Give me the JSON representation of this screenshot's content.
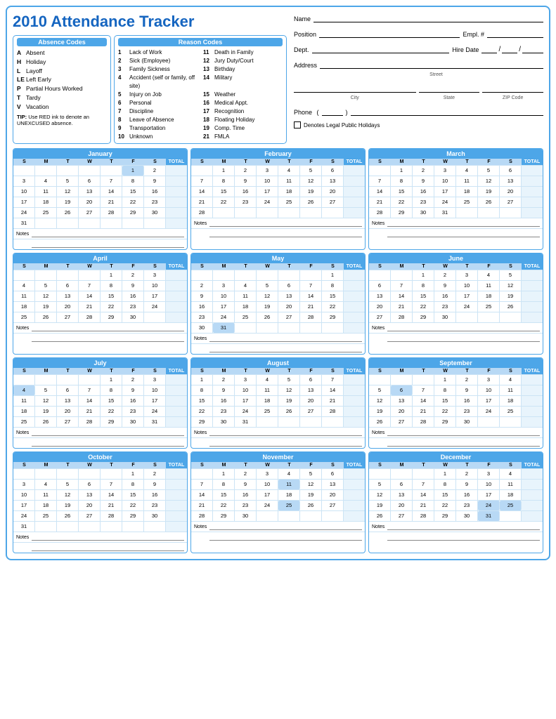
{
  "title": "2010 Attendance Tracker",
  "absenceCodes": {
    "header": "Absence Codes",
    "items": [
      {
        "letter": "A",
        "desc": "Absent"
      },
      {
        "letter": "H",
        "desc": "Holiday"
      },
      {
        "letter": "L",
        "desc": "Layoff"
      },
      {
        "letter": "LE",
        "desc": "Left Early"
      },
      {
        "letter": "P",
        "desc": "Partial Hours Worked"
      },
      {
        "letter": "T",
        "desc": "Tardy"
      },
      {
        "letter": "V",
        "desc": "Vacation"
      }
    ],
    "tip": "TIP: Use RED ink to denote an UNEXCUSED absence."
  },
  "reasonCodes": {
    "header": "Reason Codes",
    "items": [
      {
        "num": "1",
        "desc": "Lack of Work"
      },
      {
        "num": "11",
        "desc": "Death in Family"
      },
      {
        "num": "2",
        "desc": "Sick (Employee)"
      },
      {
        "num": "12",
        "desc": "Jury Duty/Court"
      },
      {
        "num": "3",
        "desc": "Family Sickness"
      },
      {
        "num": "13",
        "desc": "Birthday"
      },
      {
        "num": "4",
        "desc": "Accident (self or family, off site)"
      },
      {
        "num": "14",
        "desc": "Military"
      },
      {
        "num": "5",
        "desc": "Injury on Job"
      },
      {
        "num": "15",
        "desc": "Weather"
      },
      {
        "num": "6",
        "desc": "Personal"
      },
      {
        "num": "16",
        "desc": "Medical Appt."
      },
      {
        "num": "7",
        "desc": "Discipline"
      },
      {
        "num": "17",
        "desc": "Recognition"
      },
      {
        "num": "8",
        "desc": "Leave of Absence"
      },
      {
        "num": "18",
        "desc": "Floating Holiday"
      },
      {
        "num": "9",
        "desc": "Transportation"
      },
      {
        "num": "19",
        "desc": "Comp. Time"
      },
      {
        "num": "10",
        "desc": "Unknown"
      },
      {
        "num": "21",
        "desc": "FMLA"
      }
    ]
  },
  "form": {
    "name_label": "Name",
    "position_label": "Position",
    "empl_label": "Empl. #",
    "dept_label": "Dept.",
    "hire_label": "Hire Date",
    "address_label": "Address",
    "street_label": "Street",
    "city_label": "City",
    "state_label": "State",
    "zip_label": "ZIP Code",
    "phone_label": "Phone",
    "checkbox_label": "Denotes Legal Public Holidays"
  },
  "months": [
    {
      "name": "January",
      "weeks": [
        {
          "cells": [
            "",
            "",
            "",
            "",
            "",
            "1",
            "2"
          ]
        },
        {
          "cells": [
            "3",
            "4",
            "5",
            "6",
            "7",
            "8",
            "9"
          ]
        },
        {
          "cells": [
            "10",
            "11",
            "12",
            "13",
            "14",
            "15",
            "16"
          ]
        },
        {
          "cells": [
            "17",
            "18",
            "19",
            "20",
            "21",
            "22",
            "23"
          ]
        },
        {
          "cells": [
            "24",
            "25",
            "26",
            "27",
            "28",
            "29",
            "30"
          ]
        },
        {
          "cells": [
            "31",
            "",
            "",
            "",
            "",
            "",
            ""
          ]
        }
      ]
    },
    {
      "name": "February",
      "weeks": [
        {
          "cells": [
            "",
            "1",
            "2",
            "3",
            "4",
            "5",
            "6"
          ]
        },
        {
          "cells": [
            "7",
            "8",
            "9",
            "10",
            "11",
            "12",
            "13"
          ]
        },
        {
          "cells": [
            "14",
            "15",
            "16",
            "17",
            "18",
            "19",
            "20"
          ]
        },
        {
          "cells": [
            "21",
            "22",
            "23",
            "24",
            "25",
            "26",
            "27"
          ]
        },
        {
          "cells": [
            "28",
            "",
            "",
            "",
            "",
            "",
            ""
          ]
        }
      ]
    },
    {
      "name": "March",
      "weeks": [
        {
          "cells": [
            "",
            "1",
            "2",
            "3",
            "4",
            "5",
            "6"
          ]
        },
        {
          "cells": [
            "7",
            "8",
            "9",
            "10",
            "11",
            "12",
            "13"
          ]
        },
        {
          "cells": [
            "14",
            "15",
            "16",
            "17",
            "18",
            "19",
            "20"
          ]
        },
        {
          "cells": [
            "21",
            "22",
            "23",
            "24",
            "25",
            "26",
            "27"
          ]
        },
        {
          "cells": [
            "28",
            "29",
            "30",
            "31",
            "",
            "",
            ""
          ]
        }
      ]
    },
    {
      "name": "April",
      "weeks": [
        {
          "cells": [
            "",
            "",
            "",
            "",
            "1",
            "2",
            "3"
          ]
        },
        {
          "cells": [
            "4",
            "5",
            "6",
            "7",
            "8",
            "9",
            "10"
          ]
        },
        {
          "cells": [
            "11",
            "12",
            "13",
            "14",
            "15",
            "16",
            "17"
          ]
        },
        {
          "cells": [
            "18",
            "19",
            "20",
            "21",
            "22",
            "23",
            "24"
          ]
        },
        {
          "cells": [
            "25",
            "26",
            "27",
            "28",
            "29",
            "30",
            ""
          ]
        }
      ]
    },
    {
      "name": "May",
      "weeks": [
        {
          "cells": [
            "",
            "",
            "",
            "",
            "",
            "",
            "1"
          ]
        },
        {
          "cells": [
            "2",
            "3",
            "4",
            "5",
            "6",
            "7",
            "8"
          ]
        },
        {
          "cells": [
            "9",
            "10",
            "11",
            "12",
            "13",
            "14",
            "15"
          ]
        },
        {
          "cells": [
            "16",
            "17",
            "18",
            "19",
            "20",
            "21",
            "22"
          ]
        },
        {
          "cells": [
            "23",
            "24",
            "25",
            "26",
            "27",
            "28",
            "29"
          ]
        },
        {
          "cells": [
            "30",
            "31",
            "",
            "",
            "",
            "",
            ""
          ]
        }
      ]
    },
    {
      "name": "June",
      "weeks": [
        {
          "cells": [
            "",
            "",
            "1",
            "2",
            "3",
            "4",
            "5"
          ]
        },
        {
          "cells": [
            "6",
            "7",
            "8",
            "9",
            "10",
            "11",
            "12"
          ]
        },
        {
          "cells": [
            "13",
            "14",
            "15",
            "16",
            "17",
            "18",
            "19"
          ]
        },
        {
          "cells": [
            "20",
            "21",
            "22",
            "23",
            "24",
            "25",
            "26"
          ]
        },
        {
          "cells": [
            "27",
            "28",
            "29",
            "30",
            "",
            "",
            ""
          ]
        }
      ]
    },
    {
      "name": "July",
      "weeks": [
        {
          "cells": [
            "",
            "",
            "",
            "",
            "1",
            "2",
            "3"
          ]
        },
        {
          "cells": [
            "4",
            "5",
            "6",
            "7",
            "8",
            "9",
            "10"
          ]
        },
        {
          "cells": [
            "11",
            "12",
            "13",
            "14",
            "15",
            "16",
            "17"
          ]
        },
        {
          "cells": [
            "18",
            "19",
            "20",
            "21",
            "22",
            "23",
            "24"
          ]
        },
        {
          "cells": [
            "25",
            "26",
            "27",
            "28",
            "29",
            "30",
            "31"
          ]
        }
      ]
    },
    {
      "name": "August",
      "weeks": [
        {
          "cells": [
            "1",
            "2",
            "3",
            "4",
            "5",
            "6",
            "7"
          ]
        },
        {
          "cells": [
            "8",
            "9",
            "10",
            "11",
            "12",
            "13",
            "14"
          ]
        },
        {
          "cells": [
            "15",
            "16",
            "17",
            "18",
            "19",
            "20",
            "21"
          ]
        },
        {
          "cells": [
            "22",
            "23",
            "24",
            "25",
            "26",
            "27",
            "28"
          ]
        },
        {
          "cells": [
            "29",
            "30",
            "31",
            "",
            "",
            "",
            ""
          ]
        }
      ]
    },
    {
      "name": "September",
      "weeks": [
        {
          "cells": [
            "",
            "",
            "",
            "1",
            "2",
            "3",
            "4"
          ]
        },
        {
          "cells": [
            "5",
            "6",
            "7",
            "8",
            "9",
            "10",
            "11"
          ]
        },
        {
          "cells": [
            "12",
            "13",
            "14",
            "15",
            "16",
            "17",
            "18"
          ]
        },
        {
          "cells": [
            "19",
            "20",
            "21",
            "22",
            "23",
            "24",
            "25"
          ]
        },
        {
          "cells": [
            "26",
            "27",
            "28",
            "29",
            "30",
            "",
            ""
          ]
        }
      ]
    },
    {
      "name": "October",
      "weeks": [
        {
          "cells": [
            "",
            "",
            "",
            "",
            "",
            "1",
            "2"
          ]
        },
        {
          "cells": [
            "3",
            "4",
            "5",
            "6",
            "7",
            "8",
            "9"
          ]
        },
        {
          "cells": [
            "10",
            "11",
            "12",
            "13",
            "14",
            "15",
            "16"
          ]
        },
        {
          "cells": [
            "17",
            "18",
            "19",
            "20",
            "21",
            "22",
            "23"
          ]
        },
        {
          "cells": [
            "24",
            "25",
            "26",
            "27",
            "28",
            "29",
            "30"
          ]
        },
        {
          "cells": [
            "31",
            "",
            "",
            "",
            "",
            "",
            ""
          ]
        }
      ]
    },
    {
      "name": "November",
      "weeks": [
        {
          "cells": [
            "",
            "1",
            "2",
            "3",
            "4",
            "5",
            "6"
          ]
        },
        {
          "cells": [
            "7",
            "8",
            "9",
            "10",
            "11",
            "12",
            "13"
          ]
        },
        {
          "cells": [
            "14",
            "15",
            "16",
            "17",
            "18",
            "19",
            "20"
          ]
        },
        {
          "cells": [
            "21",
            "22",
            "23",
            "24",
            "25",
            "26",
            "27"
          ]
        },
        {
          "cells": [
            "28",
            "29",
            "30",
            "",
            "",
            "",
            ""
          ]
        }
      ]
    },
    {
      "name": "December",
      "weeks": [
        {
          "cells": [
            "",
            "",
            "",
            "1",
            "2",
            "3",
            "4"
          ]
        },
        {
          "cells": [
            "5",
            "6",
            "7",
            "8",
            "9",
            "10",
            "11"
          ]
        },
        {
          "cells": [
            "12",
            "13",
            "14",
            "15",
            "16",
            "17",
            "18"
          ]
        },
        {
          "cells": [
            "19",
            "20",
            "21",
            "22",
            "23",
            "24",
            "25"
          ]
        },
        {
          "cells": [
            "26",
            "27",
            "28",
            "29",
            "30",
            "31",
            ""
          ]
        }
      ]
    }
  ],
  "dayHeaders": [
    "S",
    "M",
    "T",
    "W",
    "T",
    "F",
    "S",
    "TOTAL"
  ],
  "notes_label": "Notes"
}
